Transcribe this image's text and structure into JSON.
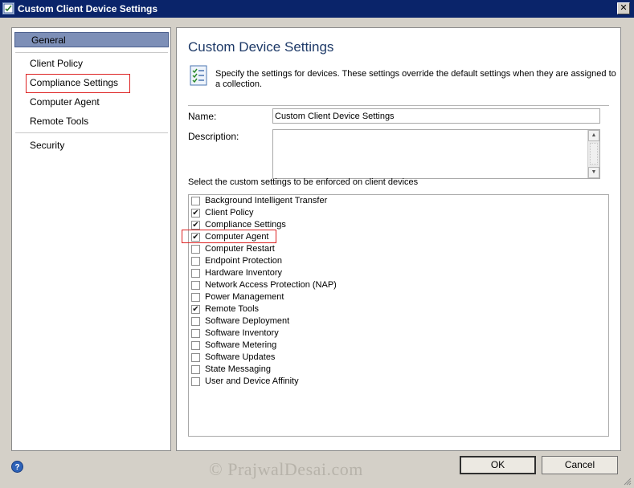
{
  "window": {
    "title": "Custom Client Device Settings",
    "close_glyph": "✕"
  },
  "nav": {
    "items": [
      {
        "label": "General",
        "selected": true
      },
      {
        "label": "Client Policy"
      },
      {
        "label": "Compliance Settings",
        "highlighted": true
      },
      {
        "label": "Computer Agent"
      },
      {
        "label": "Remote Tools"
      },
      {
        "label": "Security"
      }
    ]
  },
  "main": {
    "heading": "Custom Device Settings",
    "description": "Specify the settings for devices. These settings override the default settings when they are assigned to a collection.",
    "name_label": "Name:",
    "name_value": "Custom Client Device Settings",
    "description_label": "Description:",
    "description_value": "",
    "select_label": "Select the custom settings to be enforced on client devices",
    "settings": [
      {
        "label": "Background Intelligent Transfer",
        "checked": false
      },
      {
        "label": "Client Policy",
        "checked": true
      },
      {
        "label": "Compliance Settings",
        "checked": true
      },
      {
        "label": "Computer Agent",
        "checked": true,
        "highlighted": true
      },
      {
        "label": "Computer Restart",
        "checked": false
      },
      {
        "label": "Endpoint Protection",
        "checked": false
      },
      {
        "label": "Hardware Inventory",
        "checked": false
      },
      {
        "label": "Network Access Protection (NAP)",
        "checked": false
      },
      {
        "label": "Power Management",
        "checked": false
      },
      {
        "label": "Remote Tools",
        "checked": true
      },
      {
        "label": "Software Deployment",
        "checked": false
      },
      {
        "label": "Software Inventory",
        "checked": false
      },
      {
        "label": "Software Metering",
        "checked": false
      },
      {
        "label": "Software Updates",
        "checked": false
      },
      {
        "label": "State Messaging",
        "checked": false
      },
      {
        "label": "User and Device Affinity",
        "checked": false
      }
    ],
    "check_glyph": "✔"
  },
  "footer": {
    "help_glyph": "?",
    "watermark": "© PrajwalDesai.com",
    "ok_label": "OK",
    "cancel_label": "Cancel"
  },
  "colors": {
    "title_bar": "#0a246a",
    "nav_selected": "#7d8fb7",
    "heading": "#1e3a68",
    "highlight_box": "#dd2222"
  },
  "icons": [
    "settings-window-icon",
    "close-icon",
    "settings-list-icon",
    "scroll-up-icon",
    "scroll-down-icon",
    "help-icon",
    "resize-grip-icon"
  ]
}
